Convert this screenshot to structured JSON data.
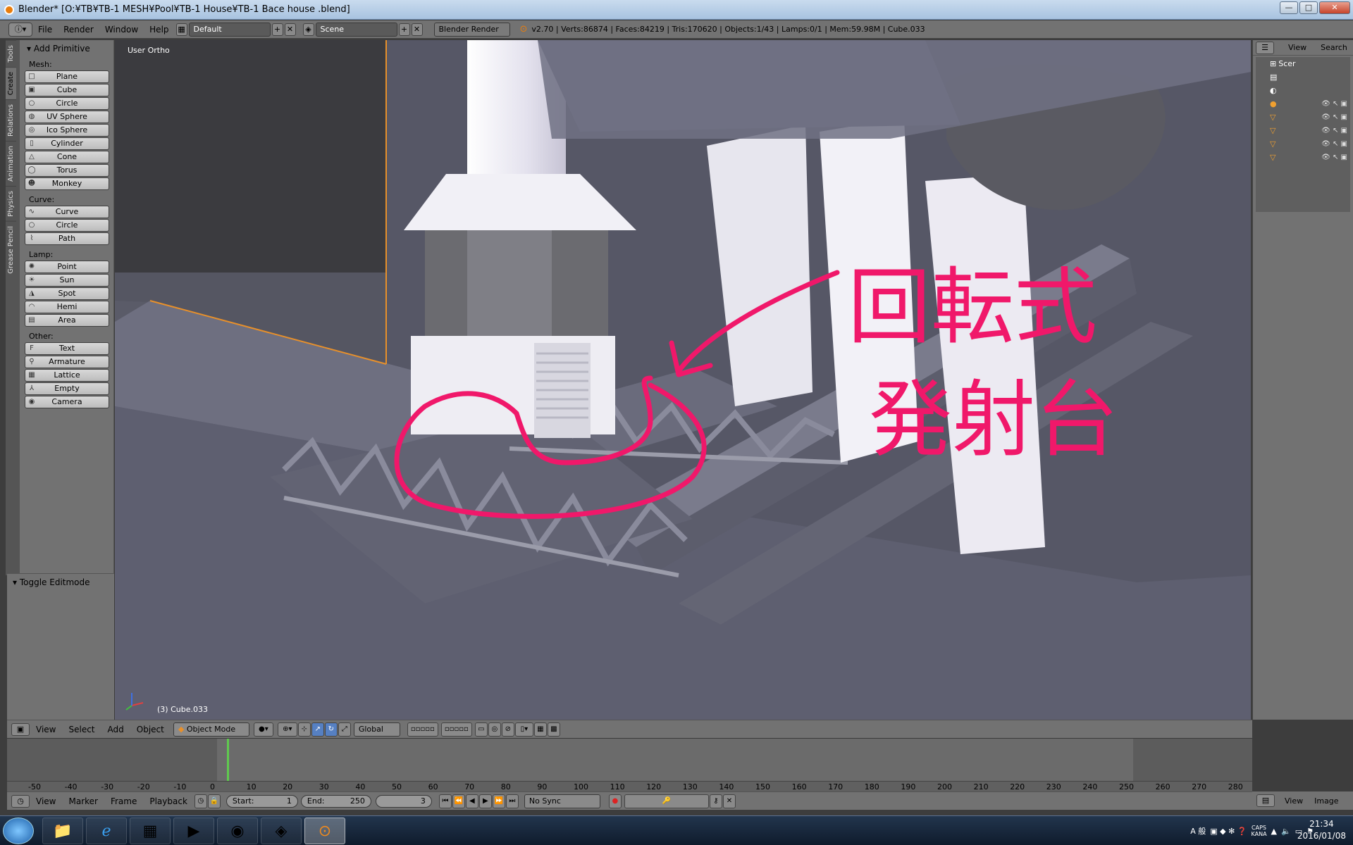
{
  "window": {
    "title": "Blender* [O:¥TB¥TB-1 MESH¥Pool¥TB-1 House¥TB-1 Bace house .blend]",
    "min": "—",
    "max": "□",
    "close": "✕"
  },
  "menubar": {
    "items": [
      "File",
      "Render",
      "Window",
      "Help"
    ],
    "screen_layout": "Default",
    "scene": "Scene",
    "render_engine": "Blender Render",
    "stats": "v2.70 | Verts:86874 | Faces:84219 | Tris:170620 | Objects:1/43 | Lamps:0/1 | Mem:59.98M | Cube.033"
  },
  "left_tabs": [
    "Tools",
    "Create",
    "Relations",
    "Animation",
    "Physics",
    "Grease Pencil"
  ],
  "toolshelf": {
    "panel_title": "Add Primitive",
    "sections": [
      {
        "label": "Mesh:",
        "buttons": [
          "Plane",
          "Cube",
          "Circle",
          "UV Sphere",
          "Ico Sphere",
          "Cylinder",
          "Cone",
          "Torus",
          "Monkey"
        ]
      },
      {
        "label": "Curve:",
        "buttons": [
          "Curve",
          "Circle",
          "Path"
        ]
      },
      {
        "label": "Lamp:",
        "buttons": [
          "Point",
          "Sun",
          "Spot",
          "Hemi",
          "Area"
        ]
      },
      {
        "label": "Other:",
        "buttons": [
          "Text",
          "Armature",
          "Lattice",
          "Empty",
          "Camera"
        ]
      }
    ],
    "operator_panel": "Toggle Editmode"
  },
  "viewport": {
    "view_label": "User Ortho",
    "object_label": "(3) Cube.033",
    "annotation_text": [
      "回転式",
      "発射台"
    ]
  },
  "outliner": {
    "menu": [
      "View",
      "Search"
    ],
    "rows": [
      "Scer",
      "",
      "",
      "",
      "",
      "",
      "",
      ""
    ]
  },
  "view3d_header": {
    "menus": [
      "View",
      "Select",
      "Add",
      "Object"
    ],
    "mode": "Object Mode",
    "orientation": "Global"
  },
  "timeline": {
    "ruler": [
      "-50",
      "-40",
      "-30",
      "-20",
      "-10",
      "0",
      "10",
      "20",
      "30",
      "40",
      "50",
      "60",
      "70",
      "80",
      "90",
      "100",
      "110",
      "120",
      "130",
      "140",
      "150",
      "160",
      "170",
      "180",
      "190",
      "200",
      "210",
      "220",
      "230",
      "240",
      "250",
      "260",
      "270",
      "280"
    ],
    "menus": [
      "View",
      "Marker",
      "Frame",
      "Playback"
    ],
    "start_label": "Start:",
    "start": "1",
    "end_label": "End:",
    "end": "250",
    "current": "3",
    "sync": "No Sync"
  },
  "image_editor_header": {
    "menus": [
      "View",
      "Image"
    ]
  },
  "taskbar": {
    "ime": "A 般",
    "caps": "CAPS",
    "kana": "KANA",
    "time": "21:34",
    "date": "2016/01/08"
  }
}
